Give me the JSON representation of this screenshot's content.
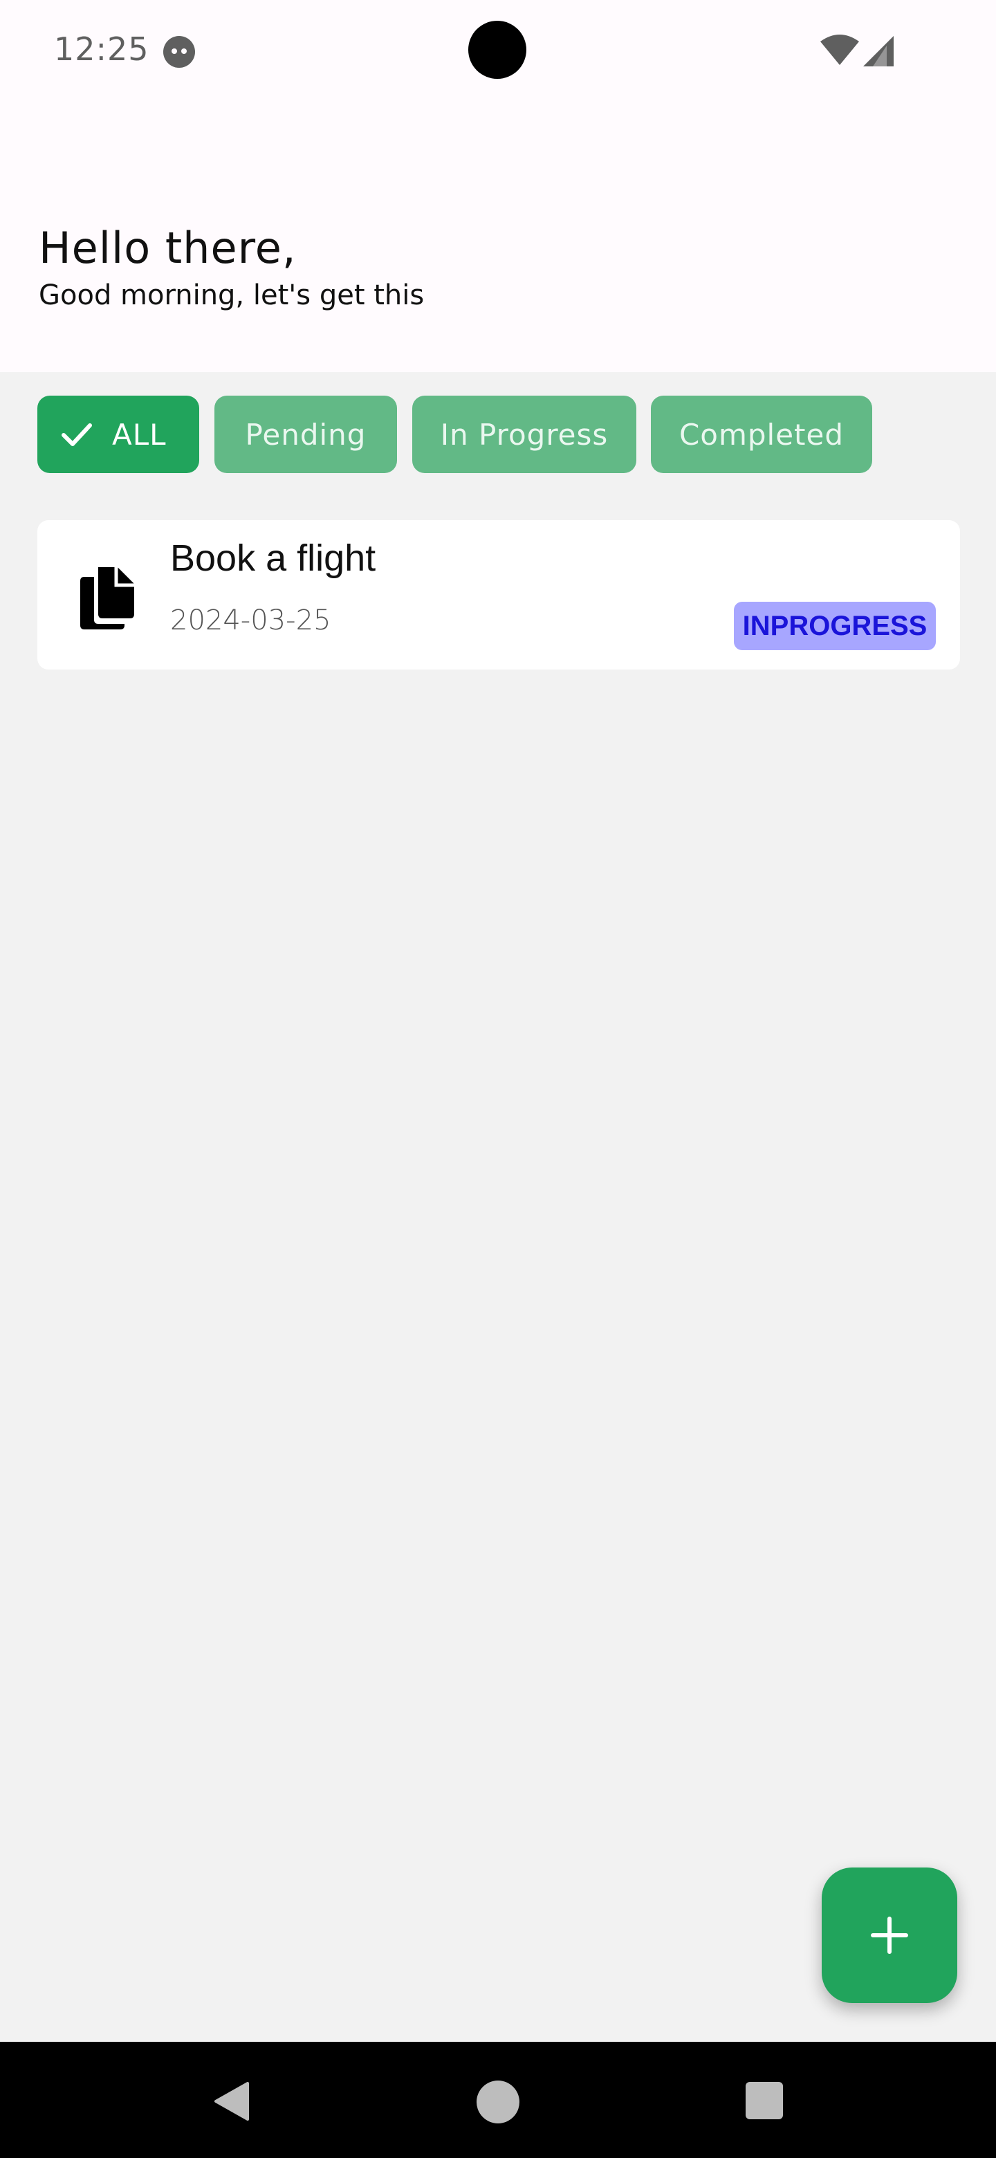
{
  "status_bar": {
    "time": "12:25"
  },
  "header": {
    "title": "Hello there,",
    "subtitle": "Good morning, let's get this"
  },
  "filters": {
    "all": "ALL",
    "pending": "Pending",
    "in_progress": "In Progress",
    "completed": "Completed",
    "selected": "ALL"
  },
  "tasks": [
    {
      "title": "Book a flight",
      "date": "2024-03-25",
      "status": "INPROGRESS",
      "icon": "documents-icon"
    }
  ],
  "fab": {
    "icon": "plus-icon"
  },
  "colors": {
    "primary": "#21a45c",
    "chip_unselected": "#62b986",
    "status_badge_bg": "#a7a6ff",
    "status_badge_text": "#1a14d9",
    "background": "#f2f2f2"
  }
}
